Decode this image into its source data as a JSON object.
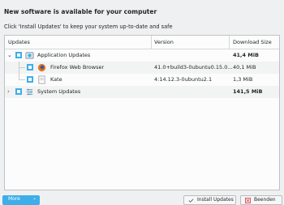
{
  "heading": "New software is available for your computer",
  "subheading": "Click 'Install Updates' to keep your system up-to-date and safe",
  "columns": [
    "Updates",
    "Version",
    "Download Size"
  ],
  "rows": [
    {
      "name": "Application Updates",
      "version": "",
      "size": "41,4 MiB"
    },
    {
      "name": "Firefox Web Browser",
      "version": "41.0+build3-0ubuntu0.15.0...",
      "size": "40,1 MiB"
    },
    {
      "name": "Kate",
      "version": "4:14.12.3-0ubuntu2.1",
      "size": "1,3 MiB"
    },
    {
      "name": "System Updates",
      "version": "",
      "size": "141,5 MiB"
    }
  ],
  "buttons": {
    "more": "More",
    "install": "Install Updates",
    "quit": "Beenden"
  },
  "colors": {
    "accent": "#3daee9",
    "background": "#eff0f1"
  }
}
